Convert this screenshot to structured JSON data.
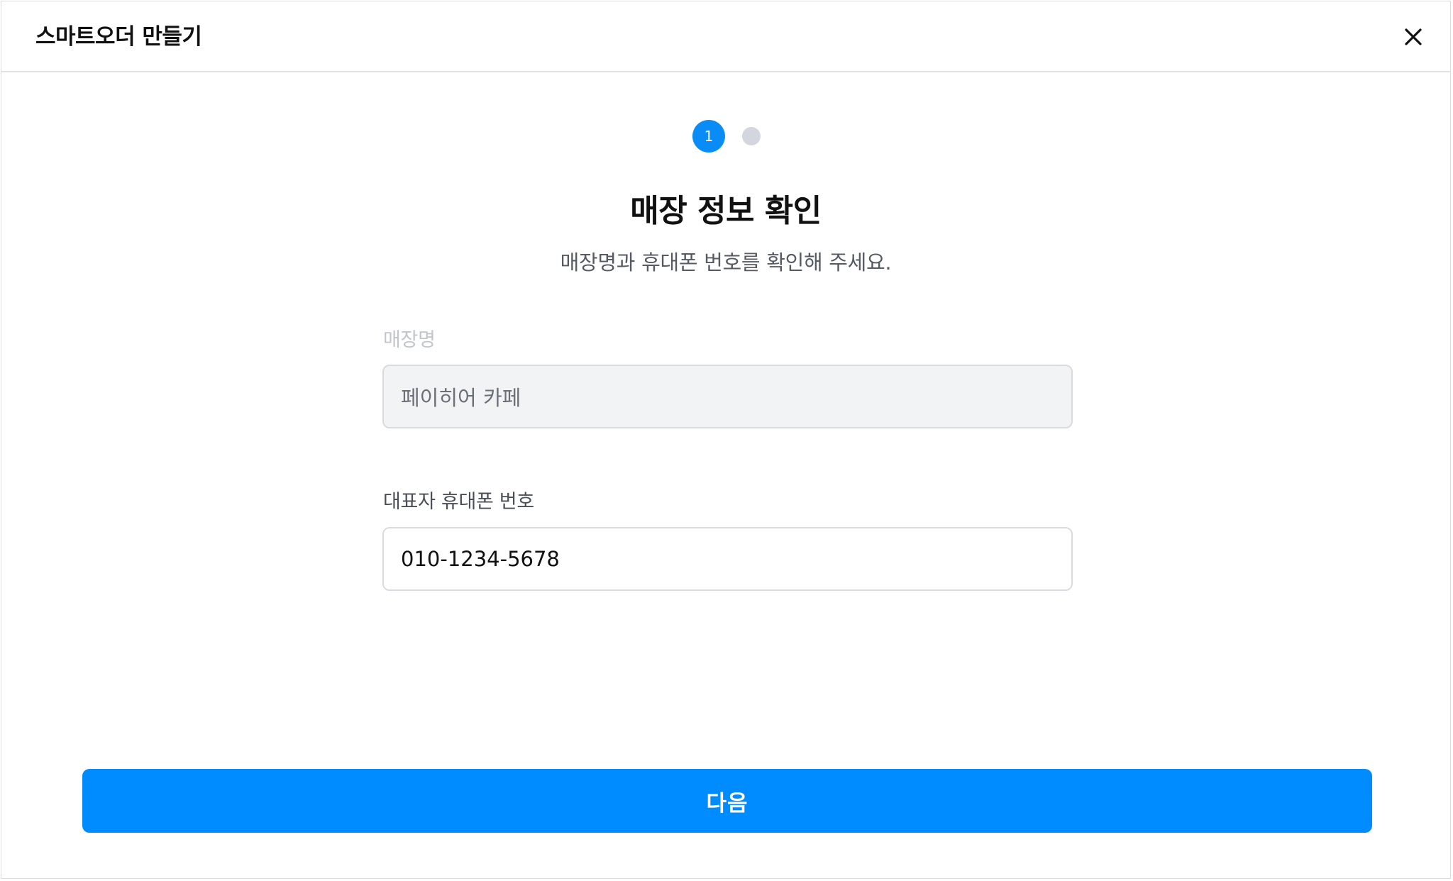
{
  "header": {
    "title": "스마트오더 만들기",
    "close_icon": "close-icon"
  },
  "stepper": {
    "current_step_label": "1",
    "total_steps": 2,
    "current_step": 1,
    "active_color": "#0a8cf7",
    "inactive_color": "#d3d6df"
  },
  "main": {
    "title": "매장 정보 확인",
    "subtitle": "매장명과 휴대폰 번호를 확인해 주세요."
  },
  "form": {
    "store_name": {
      "label": "매장명",
      "value": "페이히어 카페"
    },
    "phone": {
      "label": "대표자 휴대폰 번호",
      "value": "010-1234-5678"
    }
  },
  "footer": {
    "next_label": "다음",
    "accent_color": "#008cff"
  }
}
